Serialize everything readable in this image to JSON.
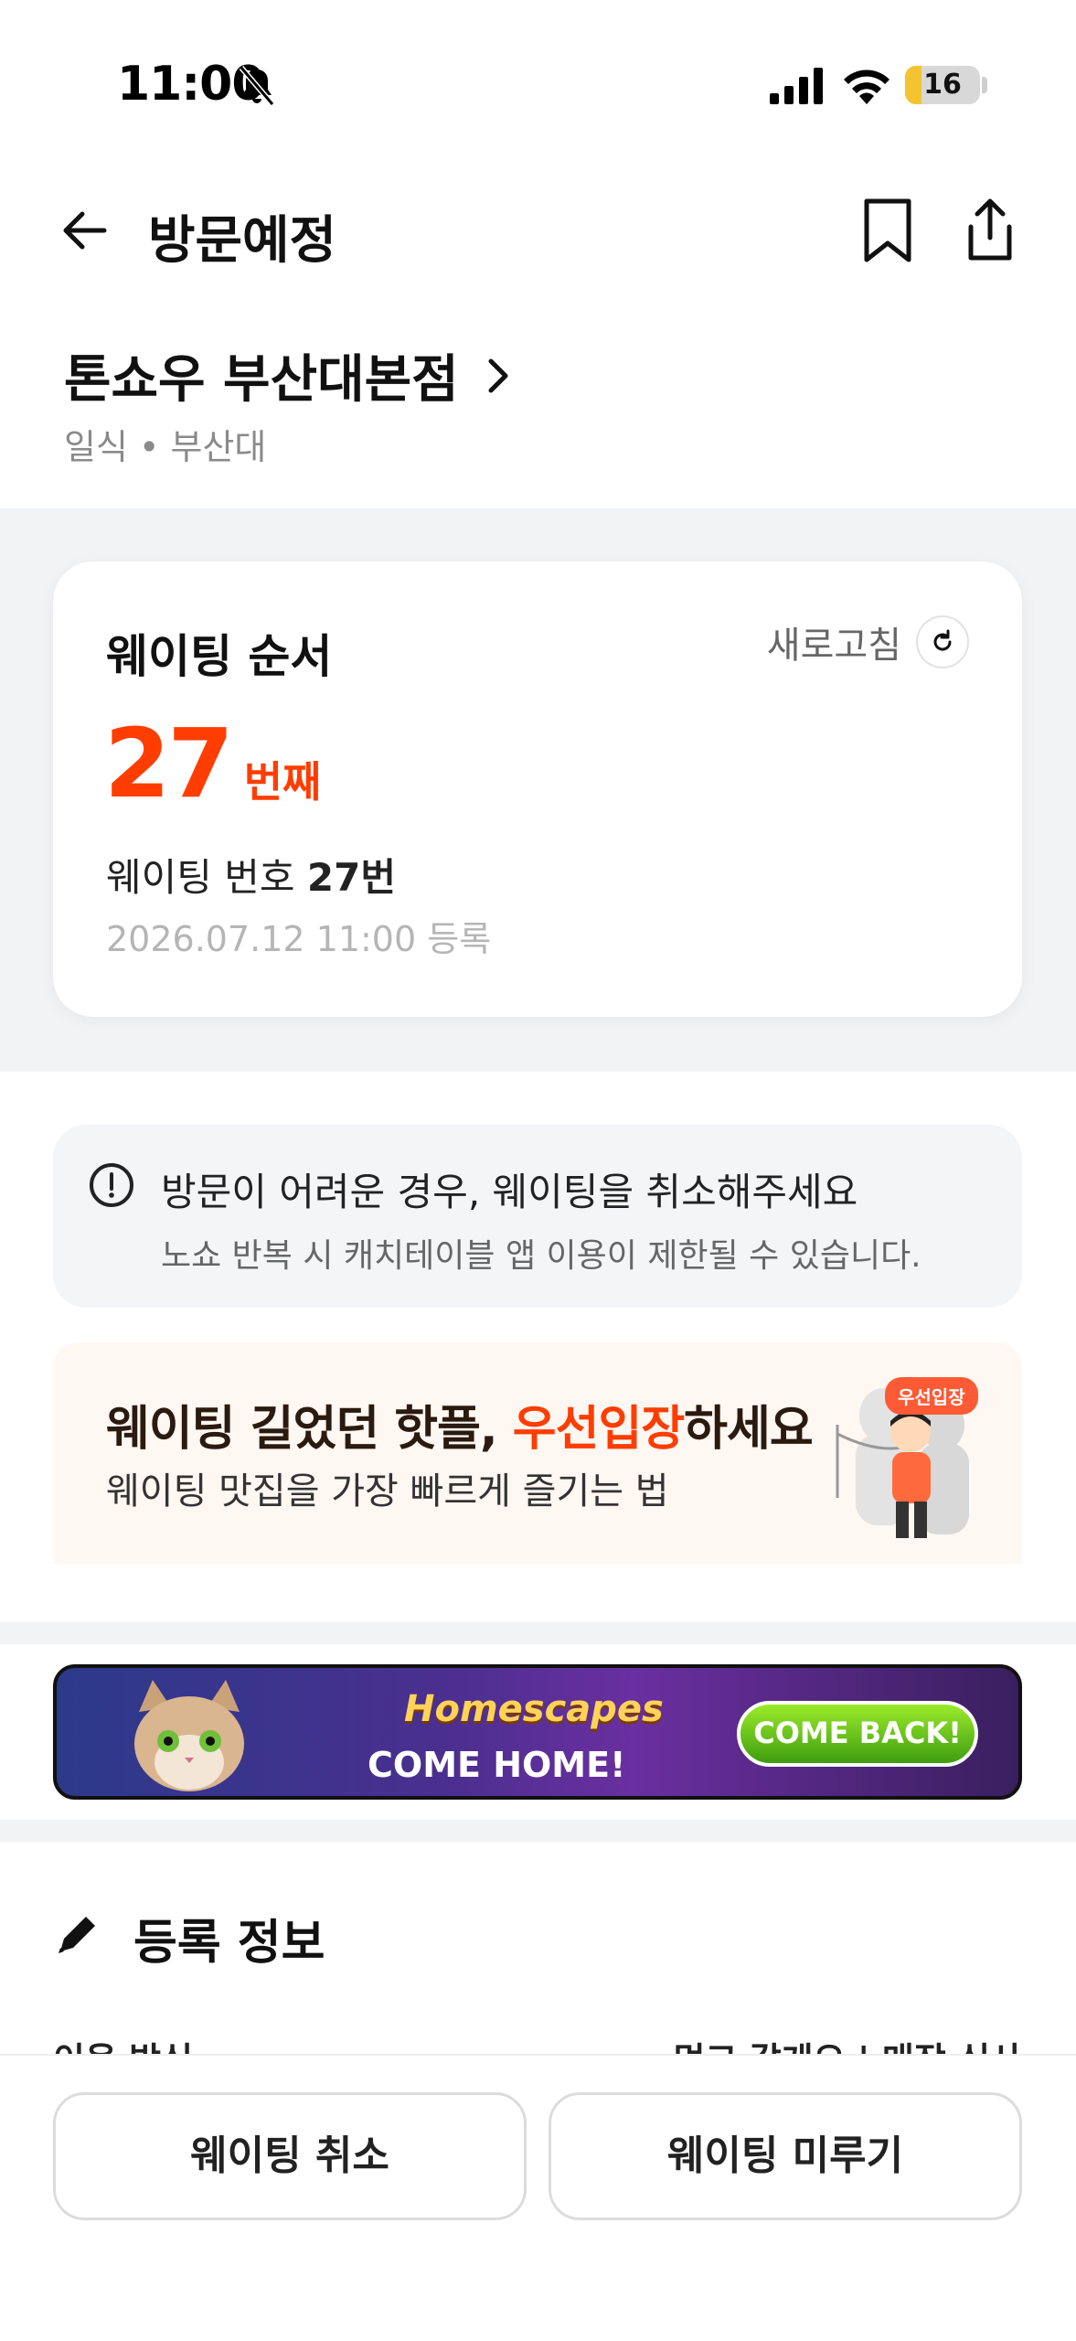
{
  "status_bar": {
    "time": "11:00",
    "battery": "16",
    "icons": [
      "bell-off-icon",
      "signal-icon",
      "wifi-icon",
      "battery-icon"
    ]
  },
  "header": {
    "title": "방문예정",
    "icons": [
      "back-arrow-icon",
      "bookmark-icon",
      "share-icon"
    ]
  },
  "store": {
    "name": "톤쇼우 부산대본점",
    "meta": "일식 • 부산대"
  },
  "queue_card": {
    "title": "웨이팅 순서",
    "refresh_label": "새로고침",
    "position_number": "27",
    "position_unit": "번째",
    "waiting_prefix": "웨이팅 번호 ",
    "waiting_number": "27번",
    "registered_at": "2026.07.12 11:00 등록",
    "accent_color": "#ff3d00"
  },
  "notice": {
    "title": "방문이 어려운 경우, 웨이팅을 취소해주세요",
    "subtitle": "노쇼 반복 시 캐치테이블 앱 이용이 제한될 수 있습니다."
  },
  "promo": {
    "title_part1": "웨이팅 길었던 핫플, ",
    "title_highlight": "우선입장",
    "title_part2": "하세요",
    "subtitle": "웨이팅 맛집을 가장 빠르게 즐기는 법",
    "badge": "우선입장"
  },
  "ad": {
    "logo_text": "Homescapes",
    "left_text": "COME HOME!",
    "button_text": "COME BACK!"
  },
  "registration": {
    "section_title": "등록 정보",
    "row_label": "이용 방식",
    "row_value": "먹고 갈게요 | 매장 식사"
  },
  "actions": {
    "cancel_label": "웨이팅 취소",
    "postpone_label": "웨이팅 미루기"
  }
}
